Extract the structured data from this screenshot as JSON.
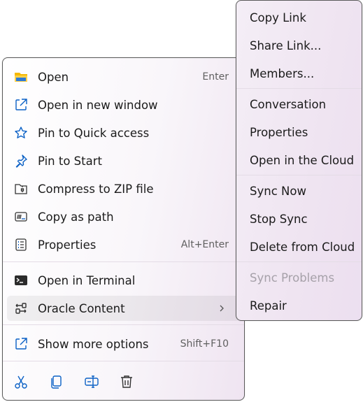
{
  "context_menu": {
    "items": [
      {
        "label": "Open",
        "shortcut": "Enter",
        "icon": "folder-icon"
      },
      {
        "label": "Open in new window",
        "icon": "open-new-window-icon"
      },
      {
        "label": "Pin to Quick access",
        "icon": "star-icon"
      },
      {
        "label": "Pin to Start",
        "icon": "pin-icon"
      },
      {
        "label": "Compress to ZIP file",
        "icon": "zip-folder-icon"
      },
      {
        "label": "Copy as path",
        "icon": "copy-path-icon"
      },
      {
        "label": "Properties",
        "shortcut": "Alt+Enter",
        "icon": "properties-icon"
      },
      {
        "label": "Open in Terminal",
        "icon": "terminal-icon"
      },
      {
        "label": "Oracle Content",
        "icon": "oracle-content-icon",
        "submenu": true
      },
      {
        "label": "Show more options",
        "shortcut": "Shift+F10",
        "icon": "show-more-icon"
      }
    ],
    "toolbar": [
      "cut-icon",
      "copy-icon",
      "rename-icon",
      "delete-icon"
    ]
  },
  "submenu": {
    "items": [
      {
        "label": "Copy Link"
      },
      {
        "label": "Share Link..."
      },
      {
        "label": "Members..."
      },
      {
        "label": "Conversation"
      },
      {
        "label": "Properties"
      },
      {
        "label": "Open in the Cloud"
      },
      {
        "label": "Sync Now"
      },
      {
        "label": "Stop Sync"
      },
      {
        "label": "Delete from Cloud"
      },
      {
        "label": "Sync Problems",
        "disabled": true
      },
      {
        "label": "Repair"
      }
    ]
  },
  "colors": {
    "accent": "#0a60c5",
    "folder": "#f5b800",
    "menu_tint": "#efe4f1"
  }
}
